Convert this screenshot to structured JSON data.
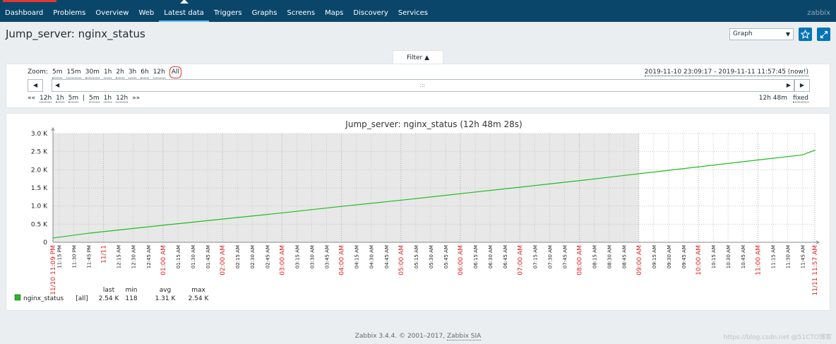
{
  "nav": {
    "items": [
      {
        "label": "Dashboard",
        "active": false
      },
      {
        "label": "Problems",
        "active": false
      },
      {
        "label": "Overview",
        "active": false
      },
      {
        "label": "Web",
        "active": false
      },
      {
        "label": "Latest data",
        "active": true
      },
      {
        "label": "Triggers",
        "active": false
      },
      {
        "label": "Graphs",
        "active": false
      },
      {
        "label": "Screens",
        "active": false
      },
      {
        "label": "Maps",
        "active": false
      },
      {
        "label": "Discovery",
        "active": false
      },
      {
        "label": "Services",
        "active": false
      }
    ],
    "brand": "zabbix"
  },
  "header": {
    "title": "Jump_server: nginx_status",
    "view_select": "Graph",
    "favorite_icon": "star-icon",
    "fullscreen_icon": "fullscreen-icon"
  },
  "filter": {
    "tab_label": "Filter ▲",
    "zoom_label": "Zoom:",
    "zoom_options": [
      "5m",
      "15m",
      "30m",
      "1h",
      "2h",
      "3h",
      "6h",
      "12h",
      "All"
    ],
    "period": "2019-11-10 23:09:17 - 2019-11-11 11:57:45 (now!)",
    "nav_left": [
      "««",
      "12h",
      "1h",
      "5m",
      "|",
      "5m",
      "1h",
      "12h",
      "»»"
    ],
    "duration": "12h 48m",
    "fixed_label": "fixed",
    "grip": ":::"
  },
  "graph": {
    "title": "Jump_server: nginx_status (12h 48m 28s)",
    "y_ticks": [
      "0",
      "0.5 K",
      "1.0 K",
      "1.5 K",
      "2.0 K",
      "2.5 K",
      "3.0 K"
    ],
    "legend": {
      "headers": [
        "last",
        "min",
        "avg",
        "max"
      ],
      "series_name": "nginx_status",
      "series_func": "[all]",
      "values": [
        "2.54 K",
        "118",
        "1.31 K",
        "2.54 K"
      ],
      "color": "#22bb22"
    },
    "shade_color": "#e8e8e8",
    "red_label_color": "#dd2222"
  },
  "chart_data": {
    "type": "line",
    "title": "Jump_server: nginx_status (12h 48m 28s)",
    "ylim": [
      0,
      3000
    ],
    "y_ticks": [
      0,
      500,
      1000,
      1500,
      2000,
      2500,
      3000
    ],
    "x_tick_labels": [
      "11/10 11:09 PM",
      "11:15 PM",
      "11:30 PM",
      "11:45 PM",
      "11/11",
      "12:15 AM",
      "12:30 AM",
      "12:45 AM",
      "01:00 AM",
      "01:15 AM",
      "01:30 AM",
      "01:45 AM",
      "02:00 AM",
      "02:15 AM",
      "02:30 AM",
      "02:45 AM",
      "03:00 AM",
      "03:15 AM",
      "03:30 AM",
      "03:45 AM",
      "04:00 AM",
      "04:15 AM",
      "04:30 AM",
      "04:45 AM",
      "05:00 AM",
      "05:15 AM",
      "05:30 AM",
      "05:45 AM",
      "06:00 AM",
      "06:15 AM",
      "06:30 AM",
      "06:45 AM",
      "07:00 AM",
      "07:15 AM",
      "07:30 AM",
      "07:45 AM",
      "08:00 AM",
      "08:15 AM",
      "08:30 AM",
      "08:45 AM",
      "09:00 AM",
      "09:15 AM",
      "09:30 AM",
      "09:45 AM",
      "10:00 AM",
      "10:15 AM",
      "10:30 AM",
      "10:45 AM",
      "11:00 AM",
      "11:15 AM",
      "11:30 AM",
      "11:45 AM",
      "11/11 11:57 AM"
    ],
    "red_tick_labels": [
      "11/10 11:09 PM",
      "11/11",
      "01:00 AM",
      "02:00 AM",
      "03:00 AM",
      "04:00 AM",
      "05:00 AM",
      "06:00 AM",
      "07:00 AM",
      "08:00 AM",
      "09:00 AM",
      "10:00 AM",
      "11:00 AM",
      "11/11 11:57 AM"
    ],
    "shaded_until": "09:00 AM",
    "series": [
      {
        "name": "nginx_status",
        "x": [
          "11/10 11:09 PM",
          "11:45 PM",
          "01:00 AM",
          "02:00 AM",
          "03:00 AM",
          "04:00 AM",
          "05:00 AM",
          "06:00 AM",
          "07:00 AM",
          "08:00 AM",
          "09:00 AM",
          "10:00 AM",
          "11:00 AM",
          "11:45 AM",
          "11/11 11:57 AM"
        ],
        "values": [
          118,
          250,
          470,
          640,
          810,
          990,
          1160,
          1340,
          1520,
          1700,
          1890,
          2080,
          2270,
          2410,
          2540
        ]
      }
    ],
    "grid": true
  },
  "footer": {
    "text": "Zabbix 3.4.4. © 2001–2017,",
    "link": "Zabbix SIA"
  },
  "watermark": "https://blog.csdn.net @51CTO博客"
}
